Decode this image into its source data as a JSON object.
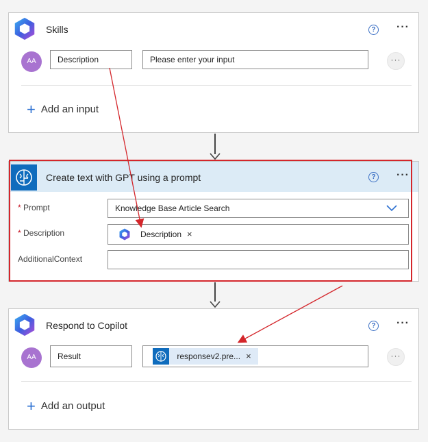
{
  "skills_card": {
    "title": "Skills",
    "help_label": "?",
    "more_label": "···",
    "avatar_label": "AA",
    "input_name": "Description",
    "input_value": "Please enter your input",
    "row_menu_label": "···",
    "add_input_label": "Add an input"
  },
  "gpt_card": {
    "title": "Create text with GPT using a prompt",
    "help_label": "?",
    "more_label": "···",
    "prompt_label": "Prompt",
    "prompt_value": "Knowledge Base Article Search",
    "description_label": "Description",
    "description_token": "Description",
    "token_remove": "×",
    "additional_context_label": "AdditionalContext",
    "additional_context_value": "",
    "required_mark": "*"
  },
  "respond_card": {
    "title": "Respond to Copilot",
    "help_label": "?",
    "more_label": "···",
    "avatar_label": "AA",
    "output_name": "Result",
    "output_token": "responsev2.pre...",
    "token_remove": "×",
    "row_menu_label": "···",
    "add_output_label": "Add an output"
  },
  "colors": {
    "accent_blue": "#2a6fd1",
    "gpt_header": "#dcebf6",
    "gpt_icon_bg": "#0f6cbd",
    "annotation_red": "#d4262b",
    "avatar_purple": "#a873d0"
  },
  "icons": {
    "copilot_logo": "copilot-logo-icon",
    "ai_brain": "ai-brain-icon",
    "plus": "plus-icon",
    "chevron": "chevron-down-icon",
    "help": "help-circle-icon"
  }
}
